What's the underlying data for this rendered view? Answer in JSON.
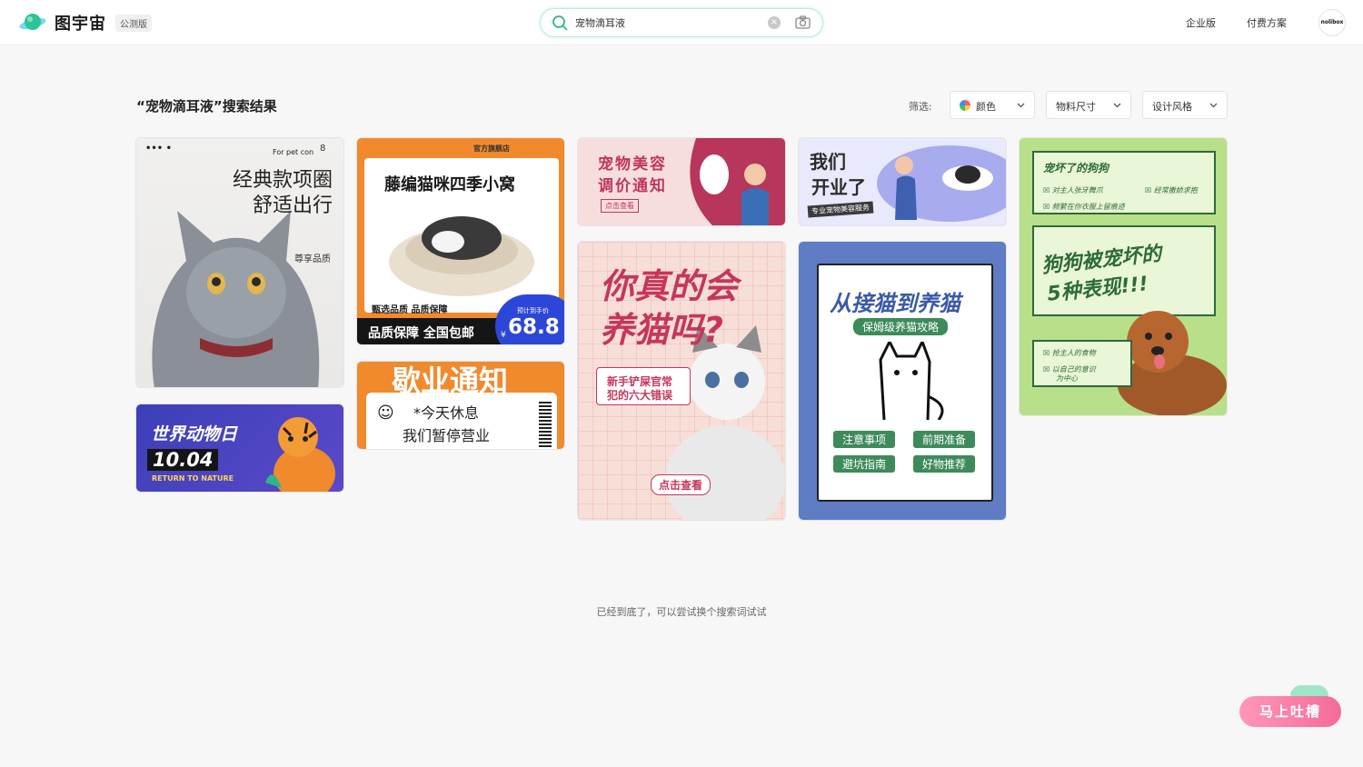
{
  "header": {
    "logo_text": "图宇宙",
    "beta_badge": "公测版",
    "search": {
      "value": "宠物滴耳液",
      "placeholder": ""
    },
    "nav": {
      "enterprise": "企业版",
      "pricing": "付费方案"
    },
    "avatar_text": "nolibox"
  },
  "results": {
    "title": "“宠物滴耳液”搜索结果",
    "filter_label": "筛选:",
    "filters": {
      "color": "颜色",
      "size": "物料尺寸",
      "style": "设计风格"
    }
  },
  "cards": {
    "cat_collar": {
      "dots": "•••  •",
      "tag": "For pet con",
      "page_count": "8",
      "line1": "经典款项圈",
      "line2": "舒适出行",
      "sub": "尊享品质"
    },
    "animal_day": {
      "line1": "世界动物日",
      "line2": "10.04",
      "sub": "RETURN TO NATURE"
    },
    "rattan_nest": {
      "top_shop": "官方旗舰店",
      "title": "藤编猫咪四季小窝",
      "tag": "甄选品质 品质保障",
      "banner": "品质保障 全国包邮",
      "price_label": "预计到手价",
      "price_symbol": "¥",
      "price": "68.8"
    },
    "closed_notice": {
      "title": "歇业通知",
      "line1": "*今天休息",
      "line2": "我们暂停营业"
    },
    "grooming": {
      "title1": "宠物美容",
      "title2": "调价通知",
      "button": "点击查看"
    },
    "opening": {
      "title1": "我们",
      "title2": "开业了",
      "sub": "专业宠物美容服务"
    },
    "raise_cat": {
      "title1": "你真的会",
      "title2": "养猫吗?",
      "bubble1": "新手铲屎官常",
      "bubble2": "犯的六大错误",
      "button": "点击查看"
    },
    "cat_guide": {
      "title": "从接猫到养猫",
      "subtitle": "保姆级养猫攻略",
      "tags": [
        "注意事项",
        "前期准备",
        "避坑指南",
        "好物推荐"
      ]
    },
    "spoiled_dog": {
      "heading": "宠坏了的狗狗",
      "check1": "对主人张牙舞爪",
      "check2": "经常撒娇求抱",
      "check3": "频繁在你衣服上留痕迹",
      "title1": "狗狗被宠坏的",
      "title2": "5种表现!!!",
      "check4": "抢主人的食物",
      "check5a": "以自己的意识",
      "check5b": "为中心"
    }
  },
  "footer_note": "已经到底了，可以尝试换个搜索词试试",
  "feedback_button": "马上吐槽",
  "colors": {
    "accent": "#20c997",
    "brand_search_border": "#b9ead9",
    "feedback": "#f46b9a"
  }
}
